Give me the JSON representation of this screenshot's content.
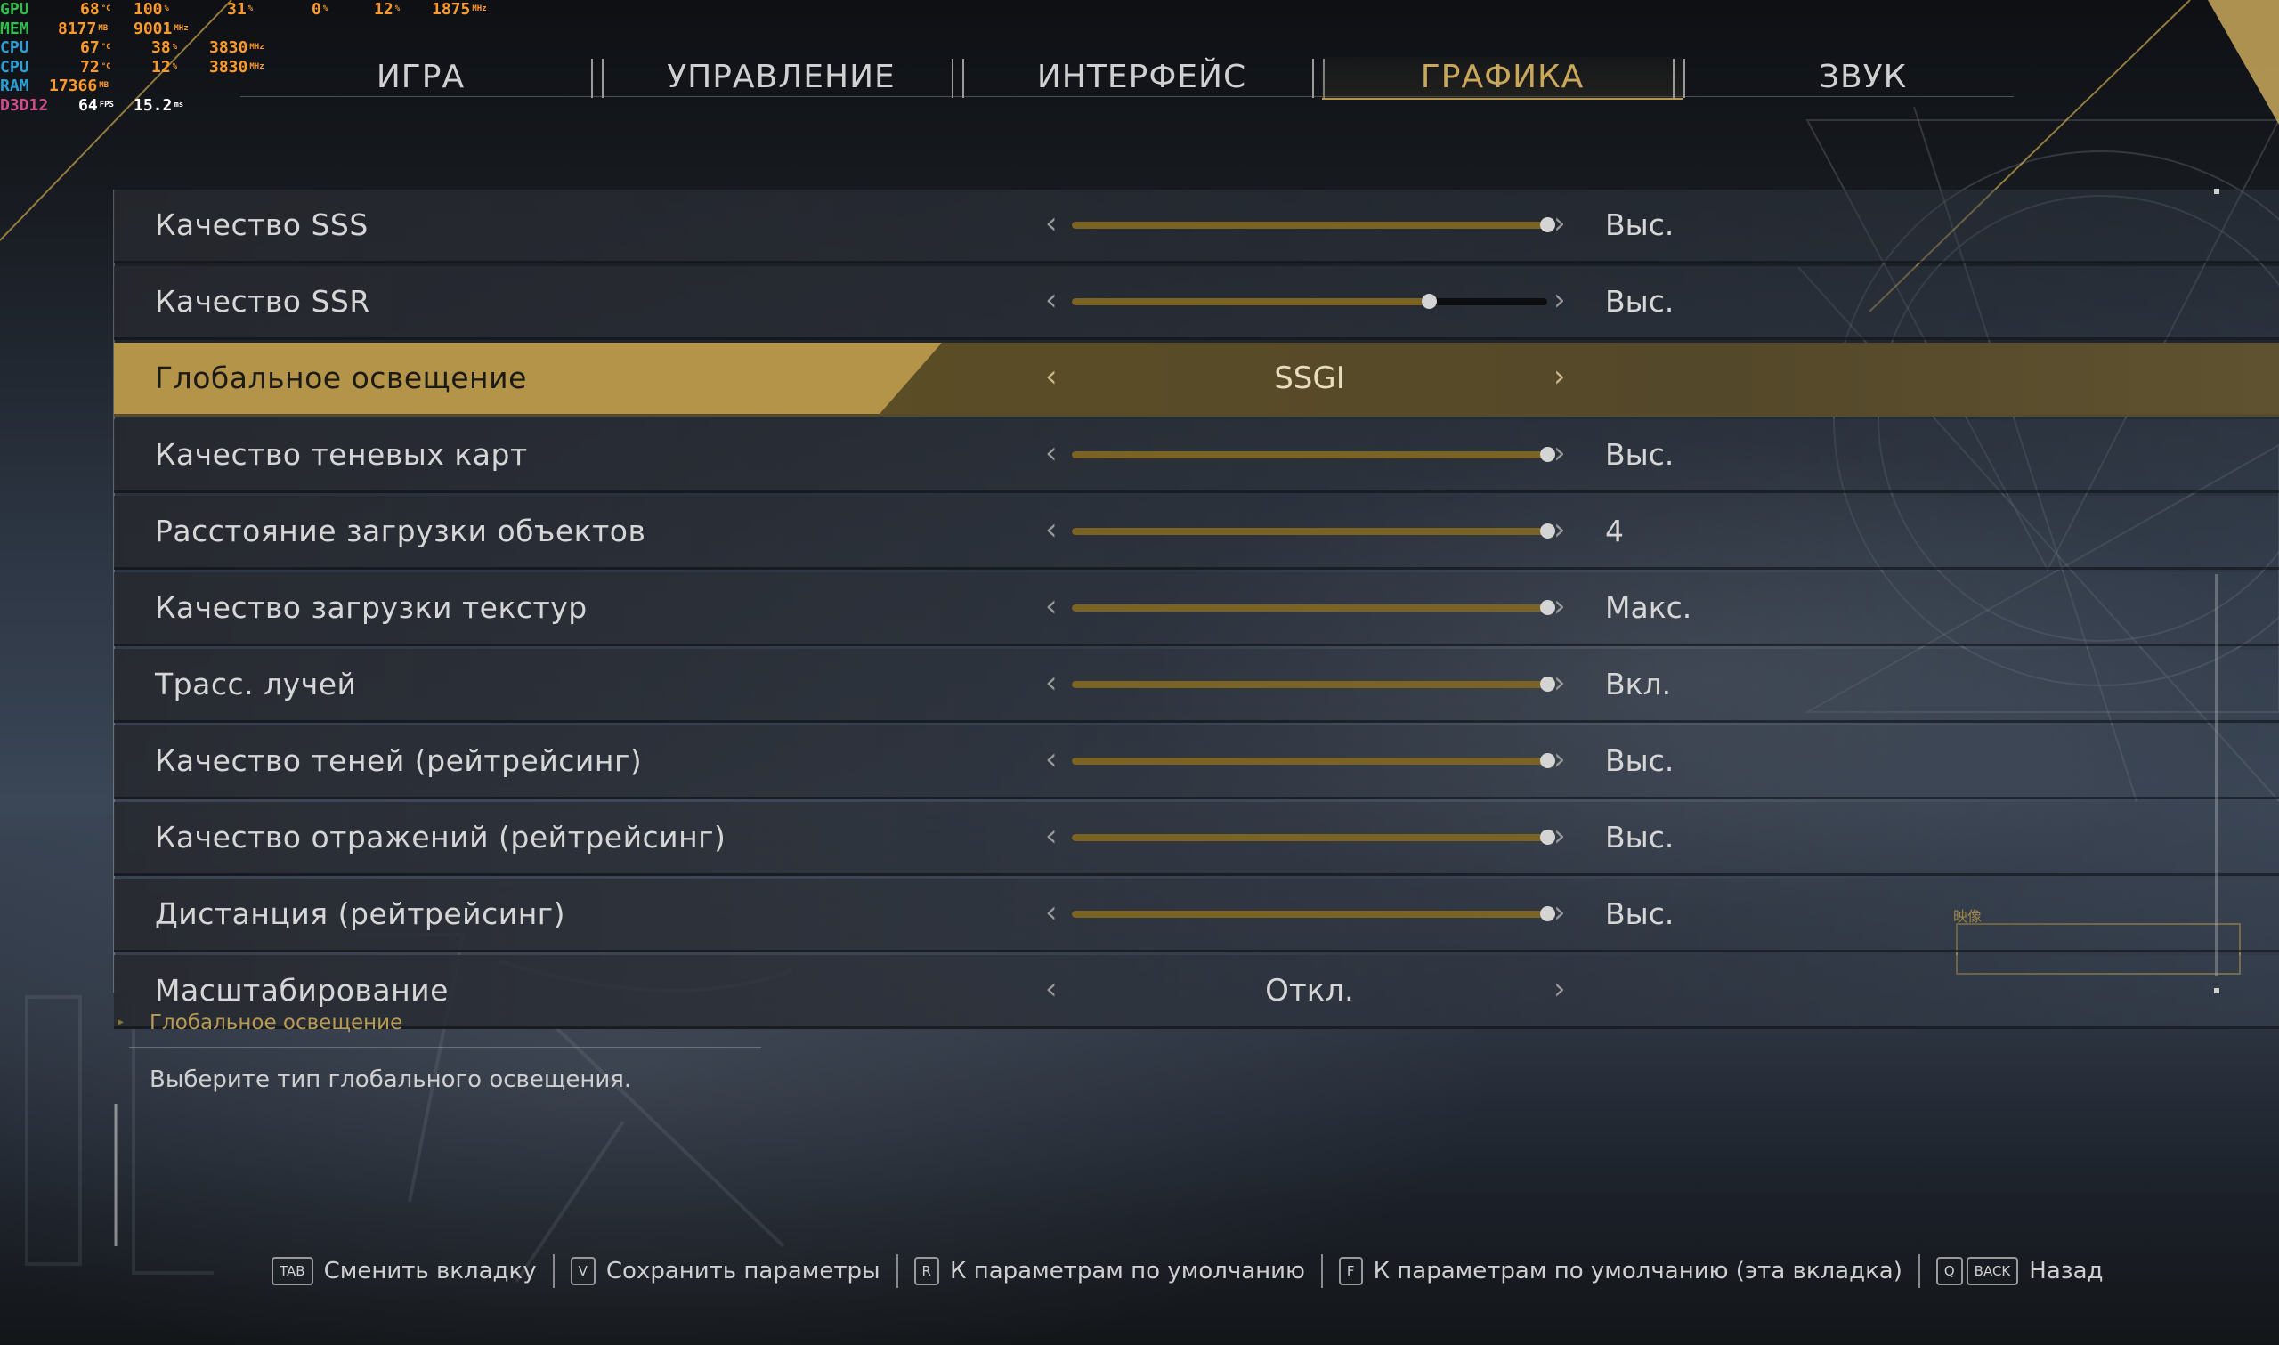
{
  "osd": {
    "rows": [
      {
        "key": "GPU",
        "color": "#2fbf4a",
        "vals": [
          {
            "v": "68",
            "u": "°C"
          },
          {
            "v": "100",
            "u": "%"
          },
          {
            "v": "31",
            "u": "%"
          },
          {
            "v": "0",
            "u": "%"
          },
          {
            "v": "12",
            "u": "%"
          },
          {
            "v": "1875",
            "u": "MHz"
          }
        ]
      },
      {
        "key": "MEM",
        "color": "#2fbf4a",
        "vals": [
          {
            "v": "8177",
            "u": "MB"
          },
          {
            "v": "9001",
            "u": "MHz"
          }
        ]
      },
      {
        "key": "CPU",
        "color": "#2aa0d8",
        "vals": [
          {
            "v": "67",
            "u": "°C"
          },
          {
            "v": "38",
            "u": "%"
          },
          {
            "v": "3830",
            "u": "MHz"
          }
        ]
      },
      {
        "key": "CPU",
        "color": "#2aa0d8",
        "vals": [
          {
            "v": "72",
            "u": "°C"
          },
          {
            "v": "12",
            "u": "%"
          },
          {
            "v": "3830",
            "u": "MHz"
          }
        ]
      },
      {
        "key": "RAM",
        "color": "#2aa0d8",
        "vals": [
          {
            "v": "17366",
            "u": "MB"
          }
        ]
      },
      {
        "key": "D3D12",
        "color": "#d24b8a",
        "vals": [
          {
            "v": "64",
            "u": "FPS"
          },
          {
            "v": "15.2",
            "u": "ms"
          }
        ]
      }
    ]
  },
  "tabs": [
    {
      "label": "ИГРА",
      "active": false
    },
    {
      "label": "УПРАВЛЕНИЕ",
      "active": false
    },
    {
      "label": "ИНТЕРФЕЙС",
      "active": false
    },
    {
      "label": "ГРАФИКА",
      "active": true
    },
    {
      "label": "ЗВУК",
      "active": false
    }
  ],
  "settings": [
    {
      "label": "Качество SSS",
      "type": "slider",
      "level": 1.0,
      "value": "Выс."
    },
    {
      "label": "Качество SSR",
      "type": "slider",
      "level": 0.75,
      "value": "Выс."
    },
    {
      "label": "Глобальное освещение",
      "type": "select",
      "value": "SSGI",
      "selected": true
    },
    {
      "label": "Качество теневых карт",
      "type": "slider",
      "level": 1.0,
      "value": "Выс."
    },
    {
      "label": "Расстояние загрузки объектов",
      "type": "slider",
      "level": 1.0,
      "value": "4"
    },
    {
      "label": "Качество загрузки текстур",
      "type": "slider",
      "level": 1.0,
      "value": "Макс."
    },
    {
      "label": "Трасс. лучей",
      "type": "slider",
      "level": 1.0,
      "value": "Вкл."
    },
    {
      "label": "Качество теней (рейтрейсинг)",
      "type": "slider",
      "level": 1.0,
      "value": "Выс."
    },
    {
      "label": "Качество отражений (рейтрейсинг)",
      "type": "slider",
      "level": 1.0,
      "value": "Выс."
    },
    {
      "label": "Дистанция (рейтрейсинг)",
      "type": "slider",
      "level": 1.0,
      "value": "Выс."
    },
    {
      "label": "Масштабирование",
      "type": "select",
      "value": "Откл."
    }
  ],
  "description": {
    "title": "Глобальное освещение",
    "text": "Выберите тип глобального освещения."
  },
  "mini_label": "映像",
  "hints": [
    {
      "keys": [
        "TAB"
      ],
      "label": "Сменить вкладку"
    },
    {
      "keys": [
        "V"
      ],
      "label": "Сохранить параметры"
    },
    {
      "keys": [
        "R"
      ],
      "label": "К параметрам по умолчанию"
    },
    {
      "keys": [
        "F"
      ],
      "label": "К параметрам по умолчанию (эта вкладка)"
    },
    {
      "keys": [
        "Q",
        "BACK"
      ],
      "label": "Назад"
    }
  ],
  "colors": {
    "accent": "#b39448",
    "accent_text": "#c9a85c",
    "slider_fill": "#7a6323"
  },
  "icons": {
    "arrow_left": "chevron-left-icon",
    "arrow_right": "chevron-right-icon"
  }
}
